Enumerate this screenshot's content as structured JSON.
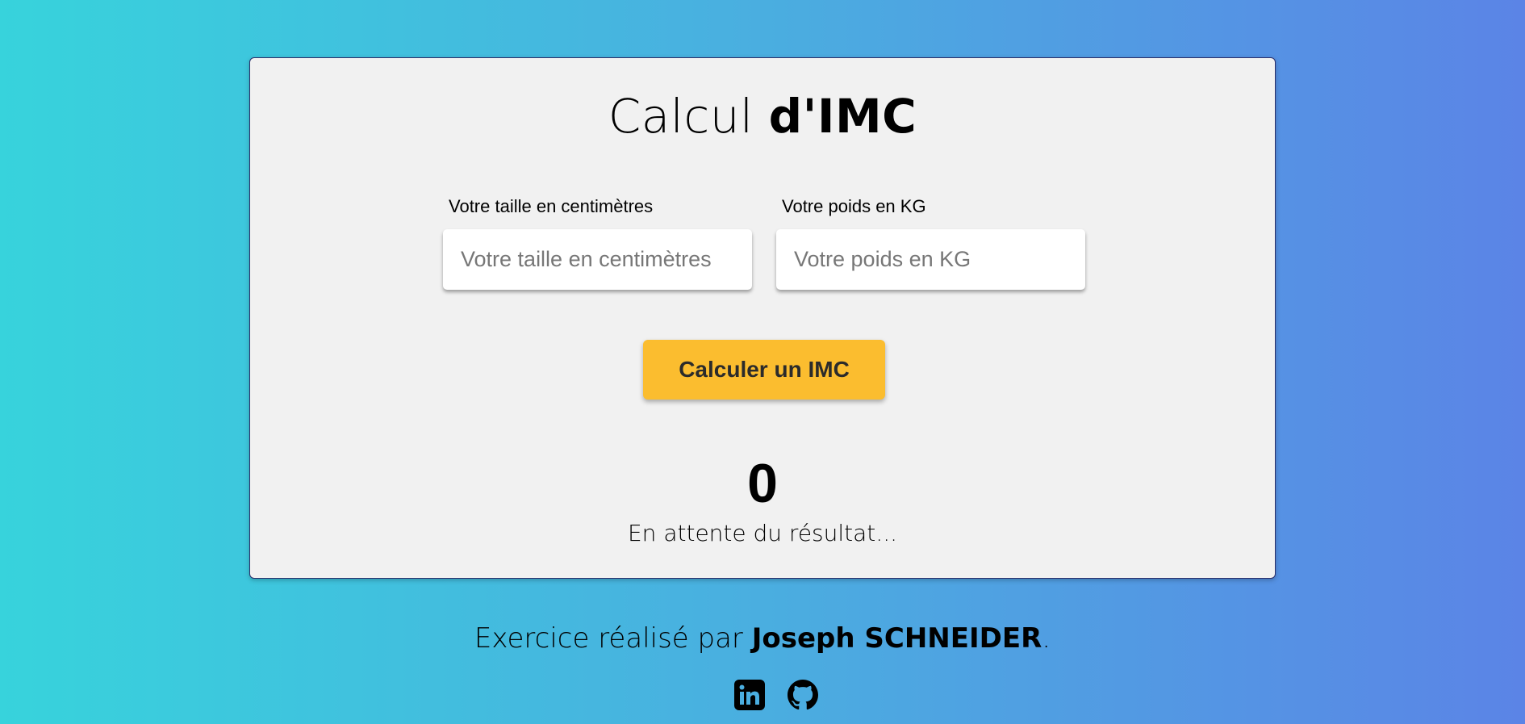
{
  "card": {
    "title": {
      "light": "Calcul",
      "bold": "d'IMC"
    },
    "height_field": {
      "label": "Votre taille en centimètres",
      "placeholder": "Votre taille en centimètres",
      "value": ""
    },
    "weight_field": {
      "label": "Votre poids en KG",
      "placeholder": "Votre poids en KG",
      "value": ""
    },
    "button_label": "Calculer un IMC",
    "result": {
      "value": "0",
      "status": "En attente du résultat..."
    }
  },
  "footer": {
    "credit_prefix": "Exercice réalisé par",
    "author": "Joseph SCHNEIDER",
    "credit_suffix": ".",
    "social_icons": [
      "linkedin-icon",
      "github-icon"
    ]
  },
  "colors": {
    "background_gradient_start": "#37d3dc",
    "background_gradient_end": "#5b84e6",
    "card_background": "#f1f1f1",
    "button_background": "#fbbd2f",
    "button_text": "#2b2b2b"
  }
}
